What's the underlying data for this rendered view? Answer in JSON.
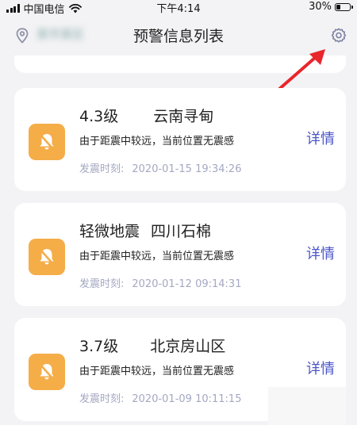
{
  "status_bar": {
    "carrier": "中国电信",
    "time": "下午4:14",
    "battery_text": "30%",
    "battery_level": 0.3,
    "wifi_icon": "wifi-icon",
    "signal_icon": "signal-icon"
  },
  "header": {
    "location_icon": "location-pin-icon",
    "location_name": "某市某区",
    "title": "预警信息列表",
    "settings_icon": "gear-icon"
  },
  "alerts": [
    {
      "magnitude": "4.3级",
      "place": "云南寻甸",
      "description": "由于距震中较远，当前位置无震感",
      "time_label": "发震时刻:",
      "time": "2020-01-15 19:34:26",
      "detail_label": "详情"
    },
    {
      "magnitude": "轻微地震",
      "place": "四川石棉",
      "description": "由于距震中较远，当前位置无震感",
      "time_label": "发震时刻:",
      "time": "2020-01-12 09:14:31",
      "detail_label": "详情"
    },
    {
      "magnitude": "3.7级",
      "place": "北京房山区",
      "description": "由于距震中较远，当前位置无震感",
      "time_label": "发震时刻:",
      "time": "2020-01-09 10:11:15",
      "detail_label": "详情"
    }
  ],
  "colors": {
    "accent": "#4a55c9",
    "bell_bg": "#f5ad48",
    "time_text": "#a4a8c2",
    "annotation_arrow": "#e8262c"
  }
}
